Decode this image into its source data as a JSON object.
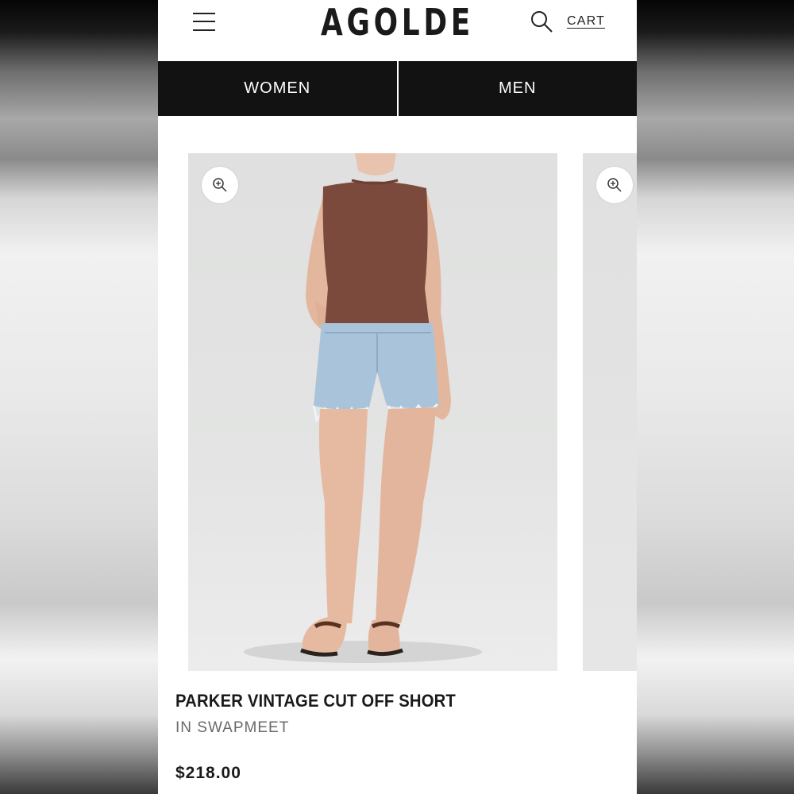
{
  "header": {
    "logo": "AGOLDE",
    "cart_label": "CART",
    "menu_icon": "hamburger-menu-icon",
    "search_icon": "search-icon"
  },
  "nav": {
    "tabs": [
      {
        "label": "WOMEN"
      },
      {
        "label": "MEN"
      }
    ]
  },
  "product": {
    "name": "PARKER VINTAGE CUT OFF SHORT",
    "color": "IN SWAPMEET",
    "price": "$218.00",
    "zoom_icon": "zoom-in-icon"
  },
  "colors": {
    "nav_background": "#121212",
    "top_color": "#7b4a3c",
    "denim_color": "#a9c3da"
  }
}
